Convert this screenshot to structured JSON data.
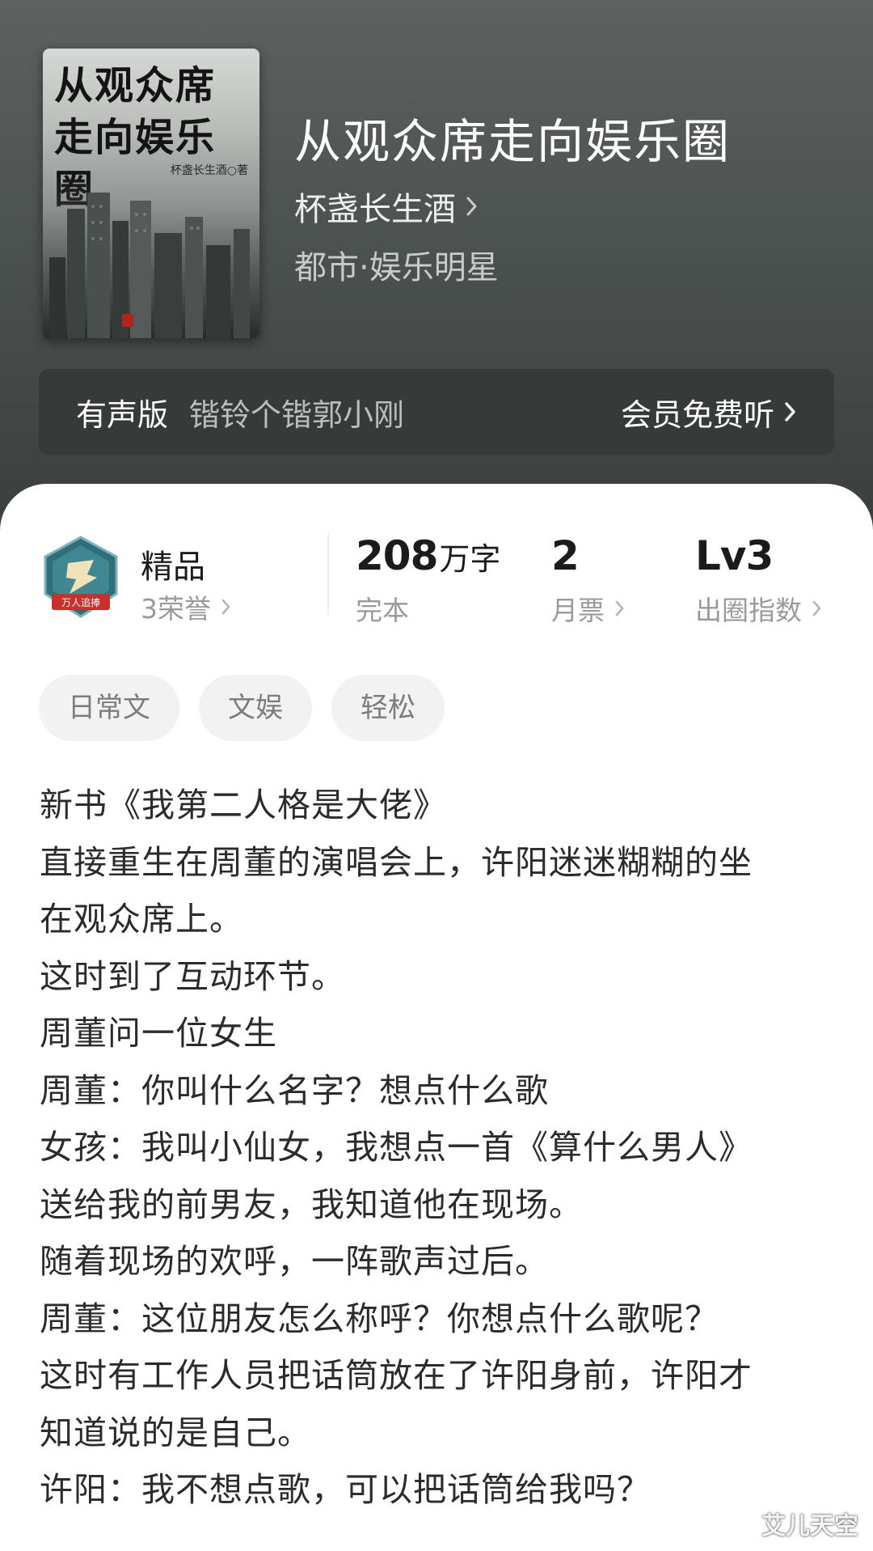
{
  "book": {
    "cover_title_line1": "从观众席",
    "cover_title_line2": "走向娱乐圈",
    "cover_author": "杯盏长生酒○著",
    "title": "从观众席走向娱乐圈",
    "author": "杯盏长生酒",
    "genre": "都市·娱乐明星"
  },
  "audio": {
    "label": "有声版",
    "narrator": "锴铃个锴郭小刚",
    "action": "会员免费听"
  },
  "stats": {
    "badge_text": "万人追捧",
    "quality": "精品",
    "honors": "3荣誉",
    "word_count": "208",
    "word_unit": "万字",
    "status": "完本",
    "monthly_votes": "2",
    "monthly_votes_label": "月票",
    "level": "Lv3",
    "level_label": "出圈指数"
  },
  "tags": [
    "日常文",
    "文娱",
    "轻松"
  ],
  "synopsis": [
    "新书《我第二人格是大佬》",
    "直接重生在周董的演唱会上，许阳迷迷糊糊的坐",
    "在观众席上。",
    "这时到了互动环节。",
    "周董问一位女生",
    "周董：你叫什么名字？想点什么歌",
    "女孩：我叫小仙女，我想点一首《算什么男人》",
    "送给我的前男友，我知道他在现场。",
    "随着现场的欢呼，一阵歌声过后。",
    "周董：这位朋友怎么称呼？你想点什么歌呢？",
    "这时有工作人员把话筒放在了许阳身前，许阳才",
    "知道说的是自己。",
    "许阳：我不想点歌，可以把话筒给我吗？"
  ],
  "watermark": "艾儿天空",
  "colors": {
    "header_dark": "#4c5250",
    "audio_bar": "#363b3a",
    "tag_bg": "#f2f2f2",
    "badge_teal": "#2f6f7a",
    "badge_red": "#c8302a"
  }
}
